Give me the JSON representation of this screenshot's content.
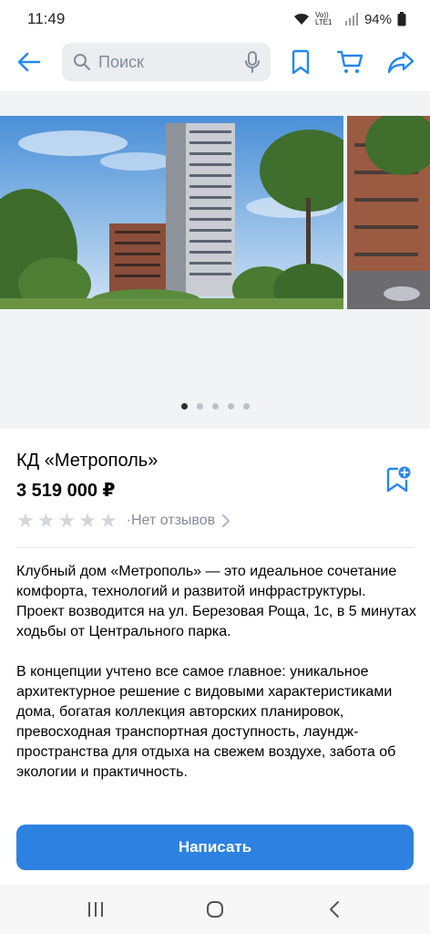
{
  "status_bar": {
    "time": "11:49",
    "network": "Vo)) LTE1",
    "battery": "94%"
  },
  "topbar": {
    "search_placeholder": "Поиск",
    "icons": [
      "back-arrow-icon",
      "search-icon",
      "mic-icon",
      "bookmark-icon",
      "cart-icon",
      "share-icon"
    ]
  },
  "gallery": {
    "photo_count": 5,
    "active_index": 0
  },
  "product": {
    "title": "КД «Метрополь»",
    "price": "3 519 000 ₽",
    "rating": 0,
    "rating_max": 5,
    "reviews_label": "·Нет отзывов"
  },
  "description": {
    "paragraph1": "Клубный дом «Метрополь» — это идеальное сочетание комфорта, технологий и развитой инфраструктуры. Проект возводится на ул. Березовая Роща, 1с, в 5 минутах ходьбы от Центрального парка.",
    "paragraph2": "В концепции учтено все самое главное: уникальное архитектурное решение с видовыми характеристиками дома, богатая коллекция авторских планировок, превосходная транспортная доступность, лаундж-пространства для отдыха на свежем воздухе, забота об экологии и практичность."
  },
  "action": {
    "write_label": "Написать"
  },
  "colors": {
    "accent": "#2d81e0",
    "icon_blue": "#2688eb",
    "muted": "#818c99"
  }
}
